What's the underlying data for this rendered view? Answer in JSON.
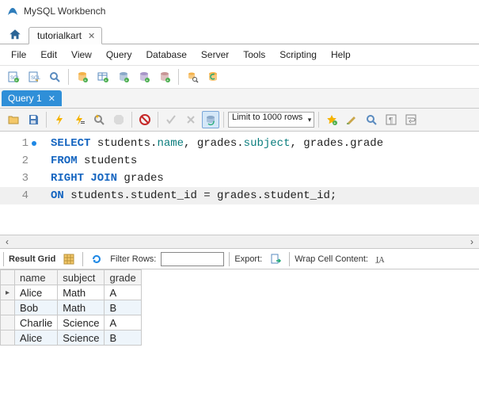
{
  "app": {
    "title": "MySQL Workbench"
  },
  "main_tab": {
    "label": "tutorialkart"
  },
  "menu": {
    "items": [
      "File",
      "Edit",
      "View",
      "Query",
      "Database",
      "Server",
      "Tools",
      "Scripting",
      "Help"
    ]
  },
  "query_tab": {
    "label": "Query 1"
  },
  "limit": {
    "label": "Limit to 1000 rows"
  },
  "editor": {
    "lines": [
      {
        "n": "1",
        "tokens": [
          [
            "kw",
            "SELECT"
          ],
          [
            "pln",
            " students."
          ],
          [
            "fn",
            "name"
          ],
          [
            "pln",
            ", grades."
          ],
          [
            "fn",
            "subject"
          ],
          [
            "pln",
            ", grades.grade"
          ]
        ]
      },
      {
        "n": "2",
        "tokens": [
          [
            "kw",
            "FROM"
          ],
          [
            "pln",
            " students"
          ]
        ]
      },
      {
        "n": "3",
        "tokens": [
          [
            "kw",
            "RIGHT JOIN"
          ],
          [
            "pln",
            " grades"
          ]
        ]
      },
      {
        "n": "4",
        "tokens": [
          [
            "kw",
            "ON"
          ],
          [
            "pln",
            " students.student_id "
          ],
          [
            "pln",
            "="
          ],
          [
            "pln",
            " grades.student_id;"
          ]
        ]
      }
    ]
  },
  "resultbar": {
    "grid_label": "Result Grid",
    "filter_label": "Filter Rows:",
    "filter_value": "",
    "export_label": "Export:",
    "wrap_label": "Wrap Cell Content:"
  },
  "results": {
    "columns": [
      "name",
      "subject",
      "grade"
    ],
    "rows": [
      [
        "Alice",
        "Math",
        "A"
      ],
      [
        "Bob",
        "Math",
        "B"
      ],
      [
        "Charlie",
        "Science",
        "A"
      ],
      [
        "Alice",
        "Science",
        "B"
      ]
    ]
  },
  "icons": {
    "home": "home-icon",
    "folder": "folder-icon",
    "save": "save-icon",
    "bolt": "execute-icon",
    "boltcur": "execute-cursor-icon",
    "explain": "explain-icon",
    "stop": "stop-icon",
    "skull": "kill-icon",
    "commit": "commit-icon",
    "rollback": "rollback-icon",
    "auto": "autocommit-icon",
    "star": "favorite-icon",
    "brush": "beautify-icon",
    "search": "search-icon",
    "panel": "panel-icon",
    "panel2": "panel2-icon",
    "grid": "grid-icon",
    "refresh": "refresh-icon",
    "export": "export-icon",
    "wrap": "wrap-icon"
  }
}
